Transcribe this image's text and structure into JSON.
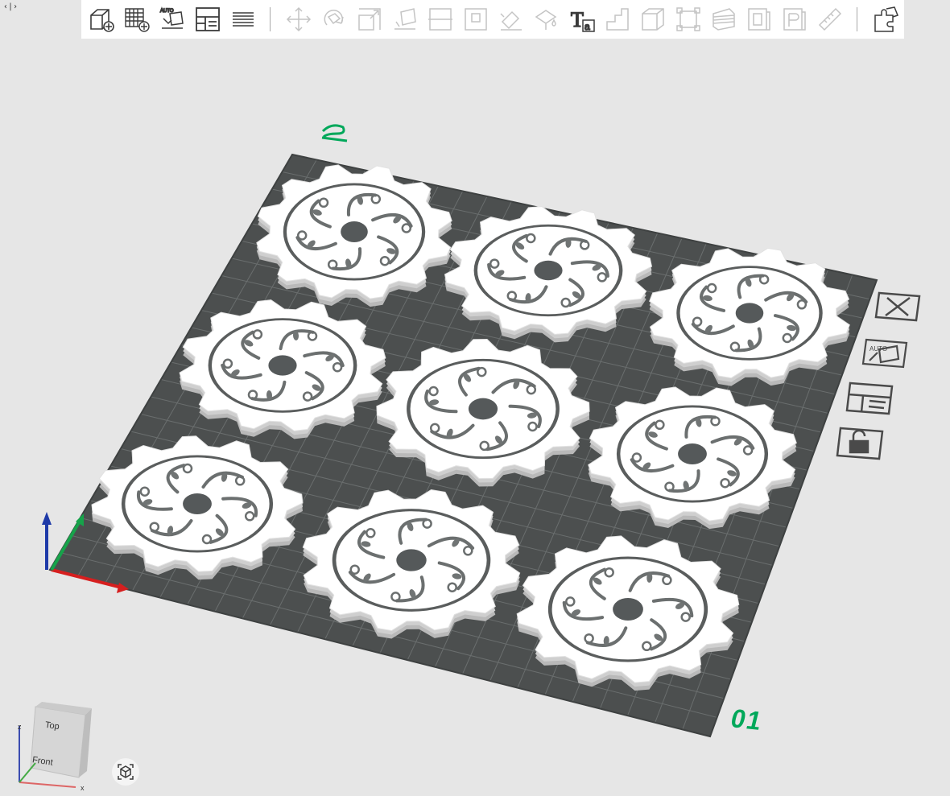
{
  "panel_toggle": {
    "label": "‹|›"
  },
  "toolbar": {
    "icons": [
      "add-object-icon",
      "add-plate-icon",
      "auto-arrange-icon",
      "layout-icon",
      "layers-icon",
      "move-icon",
      "rotate-icon",
      "scale-icon",
      "place-on-face-icon",
      "cut-icon",
      "boolean-icon",
      "support-paint-icon",
      "seam-paint-icon",
      "text-icon",
      "variable-layer-height-icon",
      "hollow-icon",
      "fix-model-icon",
      "slice-plane-icon",
      "emboss-icon",
      "brim-ears-icon",
      "measure-icon",
      "assembly-icon"
    ],
    "auto_badge": "AUTO",
    "text_tool_letter": "T",
    "text_tool_sub": "a"
  },
  "plate": {
    "name": "01",
    "color_grid": "#4c4f4f",
    "color_gear": "#ffffff"
  },
  "side_tools": {
    "delete": "close-plate-icon",
    "auto": "auto-arrange-plate-icon",
    "auto_badge": "AUTO",
    "layout": "arrange-plate-icon",
    "lock": "lock-plate-icon"
  },
  "view_cube": {
    "top": "Top",
    "front": "Front",
    "axis_z": "z",
    "axis_x": "x"
  },
  "reset_view": "reset-view-icon"
}
